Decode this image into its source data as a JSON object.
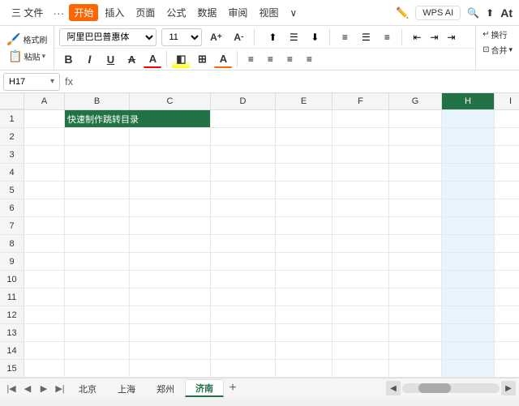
{
  "titlebar": {
    "menu_items": [
      "三 文件",
      "···",
      "开始",
      "插入",
      "页面",
      "公式",
      "数据",
      "审阅",
      "视图",
      "∨"
    ],
    "wps_ai": "WPS AI",
    "search_icon": "🔍",
    "upload_icon": "↑",
    "at_text": "At"
  },
  "ribbon": {
    "format_painter": "格式刷",
    "paste": "粘贴",
    "paste_arrow": "▾",
    "font_name": "阿里巴巴普惠体",
    "font_size": "11",
    "font_size_up": "A↑",
    "font_size_down": "A↓",
    "bold": "B",
    "italic": "I",
    "underline": "U",
    "strikethrough": "A̶",
    "font_color_btn": "A",
    "fill_color_btn": "◧",
    "border_btn": "⊞",
    "align_left": "≡",
    "align_center": "≡",
    "align_right": "≡",
    "align_top": "⬆",
    "align_mid": "⬛",
    "align_bot": "⬇",
    "wrap_text": "换行",
    "merge_cells": "合并▾",
    "indent_dec": "⇤",
    "indent_inc": "⇥",
    "increase_indent": "⇥",
    "decrease_indent": "⇤"
  },
  "formula_bar": {
    "cell_ref": "H17",
    "fx_icon": "fx"
  },
  "columns": {
    "headers": [
      "",
      "A",
      "B",
      "C",
      "D",
      "E",
      "F",
      "G",
      "H",
      "I"
    ],
    "widths": [
      30,
      50,
      80,
      100,
      80,
      70,
      70,
      65,
      65,
      40
    ]
  },
  "rows": [
    {
      "num": 1,
      "cells": [
        "",
        "快速制作跳转目录",
        "",
        "",
        "",
        "",
        "",
        "",
        ""
      ]
    },
    {
      "num": 2,
      "cells": [
        "",
        "",
        "",
        "",
        "",
        "",
        "",
        "",
        ""
      ]
    },
    {
      "num": 3,
      "cells": [
        "",
        "",
        "",
        "",
        "",
        "",
        "",
        "",
        ""
      ]
    },
    {
      "num": 4,
      "cells": [
        "",
        "",
        "",
        "",
        "",
        "",
        "",
        "",
        ""
      ]
    },
    {
      "num": 5,
      "cells": [
        "",
        "",
        "",
        "",
        "",
        "",
        "",
        "",
        ""
      ]
    },
    {
      "num": 6,
      "cells": [
        "",
        "",
        "",
        "",
        "",
        "",
        "",
        "",
        ""
      ]
    },
    {
      "num": 7,
      "cells": [
        "",
        "",
        "",
        "",
        "",
        "",
        "",
        "",
        ""
      ]
    },
    {
      "num": 8,
      "cells": [
        "",
        "",
        "",
        "",
        "",
        "",
        "",
        "",
        ""
      ]
    },
    {
      "num": 9,
      "cells": [
        "",
        "",
        "",
        "",
        "",
        "",
        "",
        "",
        ""
      ]
    },
    {
      "num": 10,
      "cells": [
        "",
        "",
        "",
        "",
        "",
        "",
        "",
        "",
        ""
      ]
    },
    {
      "num": 11,
      "cells": [
        "",
        "",
        "",
        "",
        "",
        "",
        "",
        "",
        ""
      ]
    },
    {
      "num": 12,
      "cells": [
        "",
        "",
        "",
        "",
        "",
        "",
        "",
        "",
        ""
      ]
    },
    {
      "num": 13,
      "cells": [
        "",
        "",
        "",
        "",
        "",
        "",
        "",
        "",
        ""
      ]
    },
    {
      "num": 14,
      "cells": [
        "",
        "",
        "",
        "",
        "",
        "",
        "",
        "",
        ""
      ]
    },
    {
      "num": 15,
      "cells": [
        "",
        "",
        "",
        "",
        "",
        "",
        "",
        "",
        ""
      ]
    }
  ],
  "sheet_tabs": {
    "tabs": [
      "北京",
      "上海",
      "郑州",
      "济南"
    ],
    "active_tab": "济南",
    "add_label": "+"
  },
  "colors": {
    "green_cell_bg": "#217346",
    "active_col_bg": "#217346",
    "selected_col_bg": "#b8d4f5"
  }
}
